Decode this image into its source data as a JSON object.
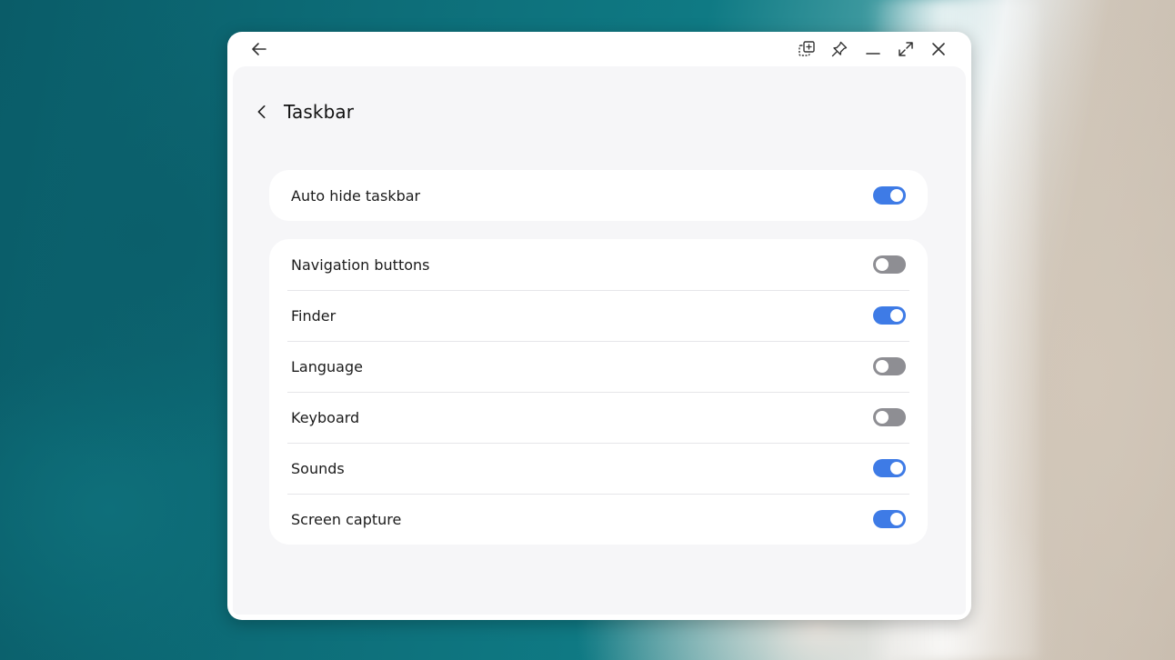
{
  "window": {
    "controls": [
      {
        "name": "snap-window-icon"
      },
      {
        "name": "pin-icon"
      },
      {
        "name": "minimize-icon"
      },
      {
        "name": "maximize-icon"
      },
      {
        "name": "close-icon"
      }
    ]
  },
  "header": {
    "title": "Taskbar"
  },
  "settings": {
    "auto_hide": {
      "label": "Auto hide taskbar",
      "on": true
    },
    "items": [
      {
        "label": "Navigation buttons",
        "on": false
      },
      {
        "label": "Finder",
        "on": true
      },
      {
        "label": "Language",
        "on": false
      },
      {
        "label": "Keyboard",
        "on": false
      },
      {
        "label": "Sounds",
        "on": true
      },
      {
        "label": "Screen capture",
        "on": true
      }
    ]
  },
  "colors": {
    "toggle_on": "#3e7be6",
    "toggle_off": "#8e8e93",
    "content_bg": "#f6f6f8"
  }
}
